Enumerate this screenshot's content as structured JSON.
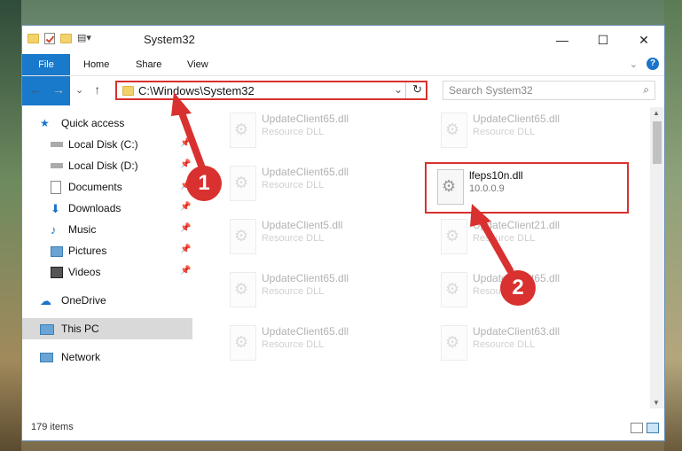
{
  "window": {
    "title": "System32"
  },
  "ribbon": {
    "tabs": [
      "File",
      "Home",
      "Share",
      "View"
    ]
  },
  "controls": {
    "minimize": "—",
    "maximize": "☐",
    "close": "✕"
  },
  "nav": {
    "back": "←",
    "forward": "→",
    "recent": "⌄",
    "up": "↑"
  },
  "address": {
    "path": "C:\\Windows\\System32"
  },
  "search": {
    "placeholder": "Search System32"
  },
  "sidebar": {
    "items": [
      {
        "label": "Quick access",
        "icon": "star-icon"
      },
      {
        "label": "Local Disk (C:)",
        "icon": "drive-icon",
        "pinned": true
      },
      {
        "label": "Local Disk (D:)",
        "icon": "drive-icon",
        "pinned": true
      },
      {
        "label": "Documents",
        "icon": "documents-icon",
        "pinned": true
      },
      {
        "label": "Downloads",
        "icon": "downloads-icon",
        "pinned": true
      },
      {
        "label": "Music",
        "icon": "music-icon",
        "pinned": true
      },
      {
        "label": "Pictures",
        "icon": "pictures-icon",
        "pinned": true
      },
      {
        "label": "Videos",
        "icon": "videos-icon",
        "pinned": true
      },
      {
        "label": "OneDrive",
        "icon": "onedrive-icon"
      },
      {
        "label": "This PC",
        "icon": "pc-icon",
        "selected": true
      },
      {
        "label": "Network",
        "icon": "network-icon"
      }
    ]
  },
  "files": [
    {
      "name": "UpdateClient65.dll",
      "desc": "Resource DLL"
    },
    {
      "name": "UpdateClient65.dll",
      "desc": "Resource DLL"
    },
    {
      "name": "UpdateClient65.dll",
      "desc": "Resource DLL"
    },
    {
      "name": "lfeps10n.dll",
      "desc": "10.0.0.9"
    },
    {
      "name": "UpdateClient5.dll",
      "desc": "Resource DLL"
    },
    {
      "name": "UpdateClient21.dll",
      "desc": "Resource DLL"
    },
    {
      "name": "UpdateClient65.dll",
      "desc": "Resource DLL"
    },
    {
      "name": "UpdateClient65.dll",
      "desc": "Resource DLL"
    },
    {
      "name": "UpdateClient65.dll",
      "desc": "Resource DLL"
    },
    {
      "name": "UpdateClient63.dll",
      "desc": "Resource DLL"
    }
  ],
  "status": {
    "count": "179 items"
  },
  "markers": {
    "one": "1",
    "two": "2"
  },
  "colors": {
    "accent": "#1979ca",
    "highlight": "#d8312f"
  }
}
